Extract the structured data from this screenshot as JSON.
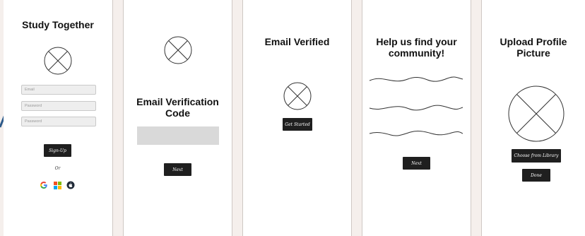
{
  "screen1": {
    "title": "Study Together",
    "email_placeholder": "Email",
    "password_placeholder": "Password",
    "confirm_password_placeholder": "Password",
    "signup_label": "Sign-Up",
    "or_label": "Or",
    "social_icons": [
      "google-icon",
      "microsoft-icon",
      "apple-icon"
    ]
  },
  "screen2": {
    "title_line1": "Email Verification",
    "title_line2": "Code",
    "next_label": "Next"
  },
  "screen3": {
    "title": "Email Verified",
    "button_label": "Get Started"
  },
  "screen4": {
    "title_line1": "Help us find your",
    "title_line2": "community!",
    "next_label": "Next"
  },
  "screen5": {
    "title_line1": "Upload Profile",
    "title_line2": "Picture",
    "choose_label": "Choose from Library",
    "done_label": "Done"
  },
  "colors": {
    "background": "#f5efec",
    "button": "#1f1f1f",
    "input_fill": "#eeeeee",
    "code_box": "#d9d9d9"
  }
}
